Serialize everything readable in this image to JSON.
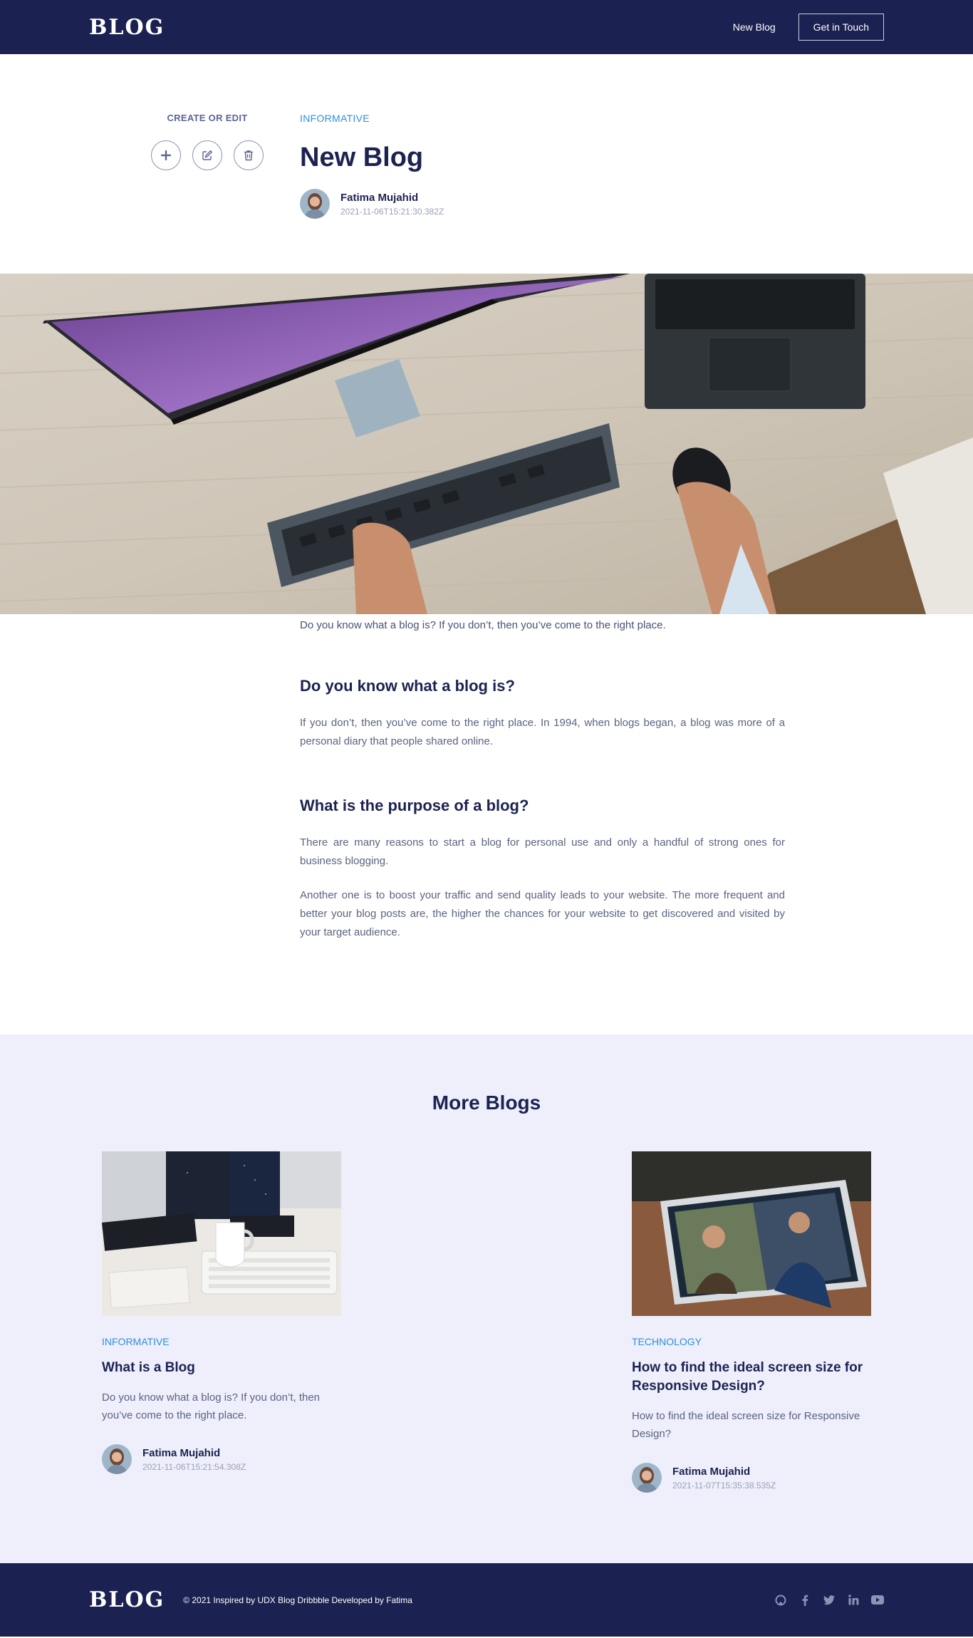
{
  "nav": {
    "logo": "BLOG",
    "new_blog": "New Blog",
    "get_in_touch": "Get in Touch"
  },
  "side": {
    "title": "CREATE OR EDIT",
    "actions": [
      "plus-icon",
      "edit-icon",
      "trash-icon"
    ]
  },
  "post": {
    "category": "INFORMATIVE",
    "title": "New Blog",
    "author": "Fatima Mujahid",
    "date": "2021-11-06T15:21:30.382Z"
  },
  "article": {
    "lead": "Do you know what a blog is? If you don’t, then you’ve come to the right place.",
    "h1": "Do you know what a blog is?",
    "p1": "If you don’t, then you’ve come to the right place. In 1994, when blogs began, a blog was more of a personal diary that people shared online.",
    "h2": "What is the purpose of a blog?",
    "p2": "There are many reasons to start a blog for personal use and only a handful of strong ones for business blogging.",
    "p3": "Another one is to boost your traffic and send quality leads to your website. The more frequent and better your blog posts are, the higher the chances for your website to get discovered and visited by your target audience."
  },
  "more": {
    "title": "More Blogs",
    "cards": [
      {
        "category": "INFORMATIVE",
        "title": "What is a Blog",
        "desc": "Do you know what a blog is? If you don’t, then you’ve come to the right place.",
        "author": "Fatima Mujahid",
        "date": "2021-11-06T15:21:54.308Z"
      },
      {
        "category": "TECHNOLOGY",
        "title": "How to find the ideal screen size for Responsive Design?",
        "desc": "How to find the ideal screen size for Responsive Design?",
        "author": "Fatima Mujahid",
        "date": "2021-11-07T15:35:38.535Z"
      }
    ]
  },
  "footer": {
    "logo": "BLOG",
    "text": "© 2021 Inspired by UDX Blog Dribbble Developed by Fatima",
    "socials": [
      "github-icon",
      "facebook-icon",
      "twitter-icon",
      "linkedin-icon",
      "youtube-icon"
    ]
  },
  "colors": {
    "navy": "#1b2150",
    "accent": "#2f8fdc",
    "section_bg": "#eeeffb"
  }
}
